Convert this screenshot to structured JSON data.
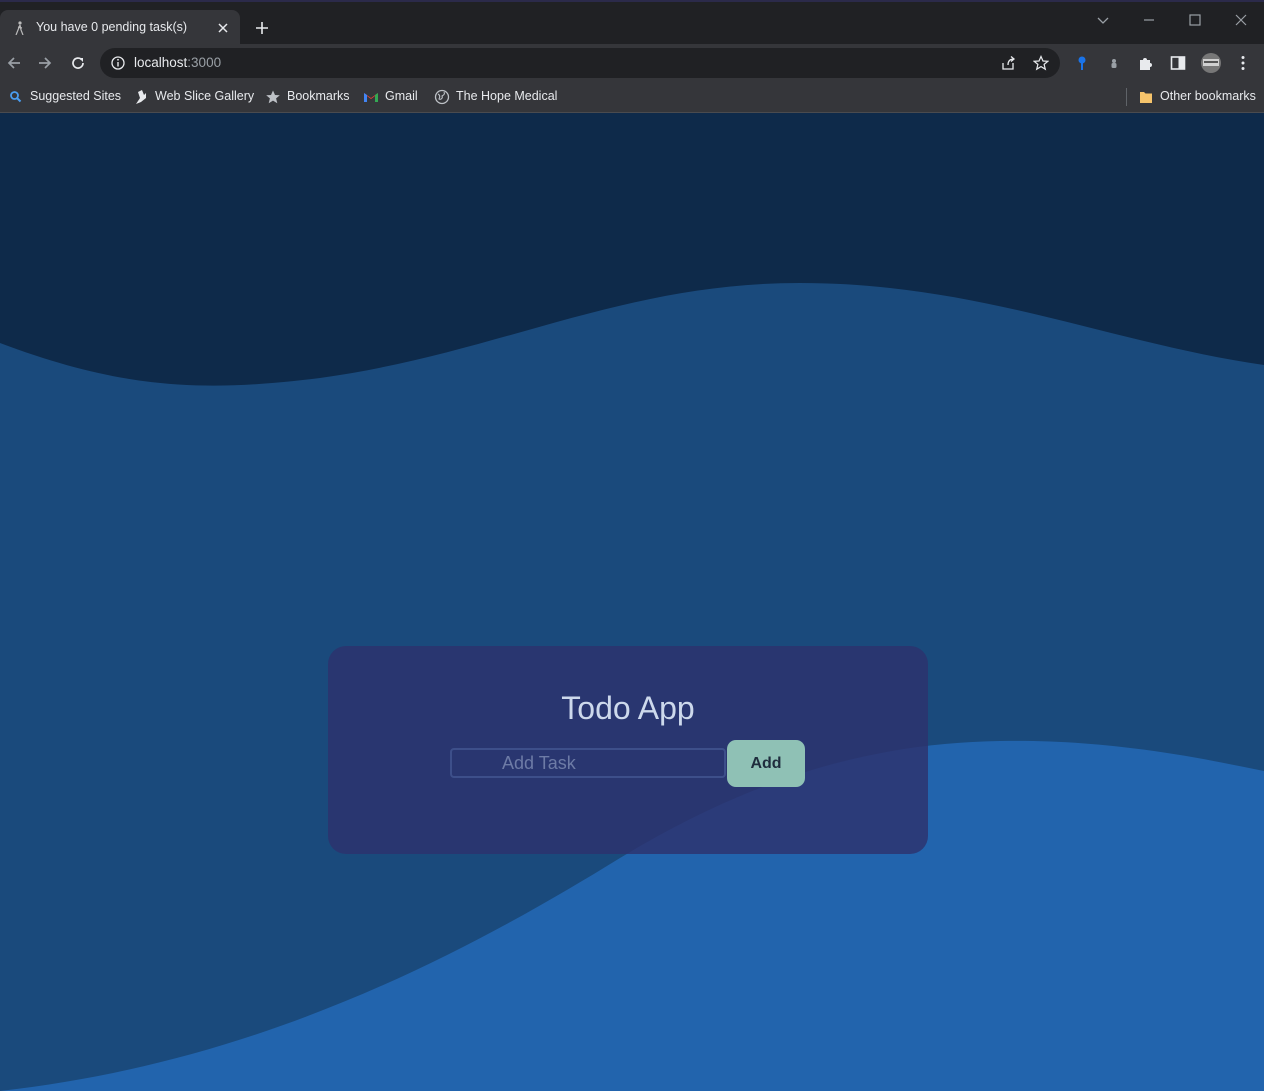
{
  "browser": {
    "tab": {
      "title": "You have 0 pending task(s)",
      "favicon": "figure-favicon-icon"
    },
    "address_bar": {
      "host": "localhost",
      "port": ":3000"
    },
    "bookmarks": [
      {
        "label": "Suggested Sites",
        "icon": "search-icon"
      },
      {
        "label": "Web Slice Gallery",
        "icon": "web-slice-icon"
      },
      {
        "label": "Bookmarks",
        "icon": "star-icon"
      },
      {
        "label": "Gmail",
        "icon": "gmail-icon"
      },
      {
        "label": "The Hope Medical",
        "icon": "globe-icon"
      }
    ],
    "other_bookmarks": {
      "label": "Other bookmarks",
      "icon": "folder-icon"
    }
  },
  "app": {
    "title": "Todo App",
    "input": {
      "placeholder": "Add Task",
      "value": ""
    },
    "add_label": "Add"
  },
  "colors": {
    "page_background": "#0e2a4a",
    "middle_wave": "#1a4a7c",
    "front_wave": "#2264ad",
    "card": "#2d326e",
    "add_button": "#8fc1b5"
  }
}
